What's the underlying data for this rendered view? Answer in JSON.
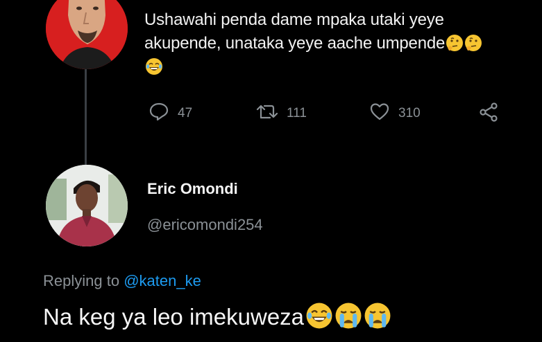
{
  "original_tweet": {
    "text_line1": "Ushawahi penda dame mpaka utaki yeye",
    "text_line2": "akupende, unataka yeye aache umpende",
    "emojis": [
      "thinking-face",
      "thinking-face",
      "laughing-face"
    ],
    "replies": "47",
    "retweets": "111",
    "likes": "310"
  },
  "reply_tweet": {
    "display_name": "Eric Omondi",
    "handle": "@ericomondi254",
    "replying_prefix": "Replying to",
    "replying_to": "@katen_ke",
    "text": "Na keg ya leo imekuweza",
    "emojis": [
      "laughing-face",
      "crying-face",
      "crying-face"
    ]
  },
  "colors": {
    "background": "#000000",
    "secondary_text": "#8b9196",
    "link": "#1d9bf0",
    "emoji_yellow": "#f7c531",
    "top_avatar_bg": "#d71f1f"
  }
}
